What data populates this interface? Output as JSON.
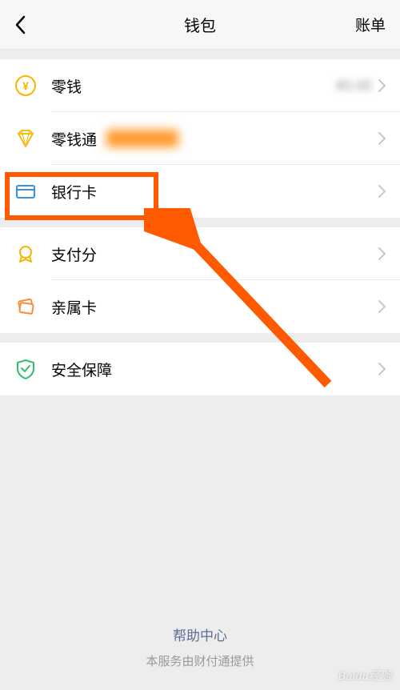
{
  "header": {
    "title": "钱包",
    "right": "账单"
  },
  "sections": [
    {
      "items": [
        {
          "icon": "yen-circle-icon",
          "label": "零钱",
          "value": "¥0.00"
        },
        {
          "icon": "diamond-icon",
          "label": "零钱通",
          "censored": true
        },
        {
          "icon": "card-icon",
          "label": "银行卡"
        }
      ]
    },
    {
      "items": [
        {
          "icon": "badge-icon",
          "label": "支付分"
        },
        {
          "icon": "cards-icon",
          "label": "亲属卡"
        }
      ]
    },
    {
      "items": [
        {
          "icon": "shield-icon",
          "label": "安全保障"
        }
      ]
    }
  ],
  "footer": {
    "help": "帮助中心",
    "provider": "本服务由财付通提供"
  },
  "watermark": "Baidu经验"
}
